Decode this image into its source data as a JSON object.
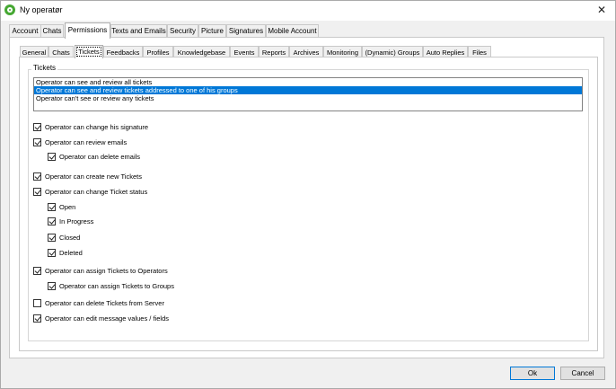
{
  "window": {
    "title": "Ny operatør"
  },
  "top_tabs": [
    {
      "label": "Account"
    },
    {
      "label": "Chats"
    },
    {
      "label": "Permissions"
    },
    {
      "label": "Texts and Emails"
    },
    {
      "label": "Security"
    },
    {
      "label": "Picture"
    },
    {
      "label": "Signatures"
    },
    {
      "label": "Mobile Account"
    }
  ],
  "active_top_tab": "Permissions",
  "sub_tabs": [
    {
      "label": "General"
    },
    {
      "label": "Chats"
    },
    {
      "label": "Tickets"
    },
    {
      "label": "Feedbacks"
    },
    {
      "label": "Profiles"
    },
    {
      "label": "Knowledgebase"
    },
    {
      "label": "Events"
    },
    {
      "label": "Reports"
    },
    {
      "label": "Archives"
    },
    {
      "label": "Monitoring"
    },
    {
      "label": "(Dynamic) Groups"
    },
    {
      "label": "Auto Replies"
    },
    {
      "label": "Files"
    }
  ],
  "active_sub_tab": "Tickets",
  "tickets": {
    "legend": "Tickets",
    "list_items": [
      {
        "label": "Operator can see and review all tickets",
        "selected": false
      },
      {
        "label": "Operator can see and review tickets addressed to one of his groups",
        "selected": true
      },
      {
        "label": "Operator can't see or review any tickets",
        "selected": false
      }
    ],
    "checkboxes": [
      {
        "label": "Operator can change his signature",
        "checked": true
      },
      {
        "label": "Operator can review emails",
        "checked": true
      },
      {
        "label": "Operator can delete emails",
        "checked": true
      },
      {
        "label": "Operator can create new Tickets",
        "checked": true
      },
      {
        "label": "Operator can change Ticket status",
        "checked": true
      },
      {
        "label": "Open",
        "checked": true
      },
      {
        "label": "In Progress",
        "checked": true
      },
      {
        "label": "Closed",
        "checked": true
      },
      {
        "label": "Deleted",
        "checked": true
      },
      {
        "label": "Operator can assign Tickets to Operators",
        "checked": true
      },
      {
        "label": "Operator can assign Tickets to Groups",
        "checked": true
      },
      {
        "label": "Operator can delete Tickets from Server",
        "checked": false
      },
      {
        "label": "Operator can edit message values / fields",
        "checked": true
      }
    ]
  },
  "buttons": {
    "ok": "Ok",
    "cancel": "Cancel"
  },
  "colors": {
    "selection": "#0078d7",
    "accent_icon": "#46a833"
  }
}
